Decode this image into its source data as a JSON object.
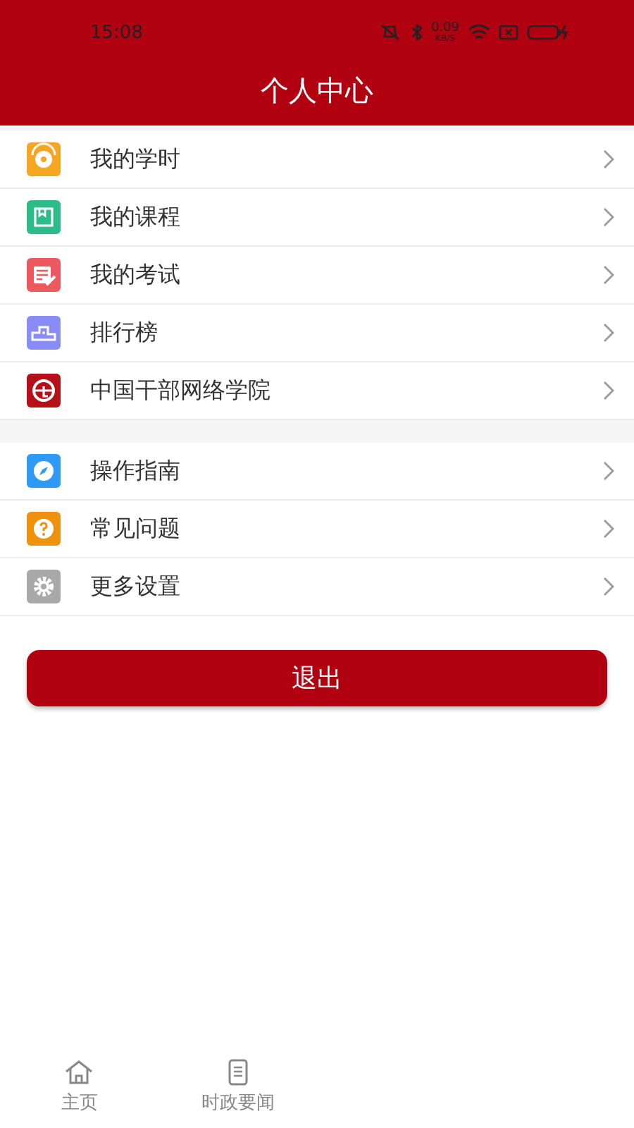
{
  "status_bar": {
    "time": "15:08",
    "speed": "0.09",
    "speed_unit": "KB/S"
  },
  "header": {
    "title": "个人中心"
  },
  "menu_groups": [
    {
      "items": [
        {
          "label": "我的学时",
          "color": "#f5a623"
        },
        {
          "label": "我的课程",
          "color": "#2dbb8a"
        },
        {
          "label": "我的考试",
          "color": "#ec5a5f"
        },
        {
          "label": "排行榜",
          "color": "#8a8cf5"
        },
        {
          "label": "中国干部网络学院",
          "color": "#b5101a"
        }
      ]
    },
    {
      "items": [
        {
          "label": "操作指南",
          "color": "#2e9af5"
        },
        {
          "label": "常见问题",
          "color": "#f0900f"
        },
        {
          "label": "更多设置",
          "color": "#a9a9a9"
        }
      ]
    }
  ],
  "logout_button": {
    "label": "退出"
  },
  "tab_bar": [
    {
      "label": "主页",
      "selected": false
    },
    {
      "label": "时政要闻",
      "selected": false
    }
  ]
}
